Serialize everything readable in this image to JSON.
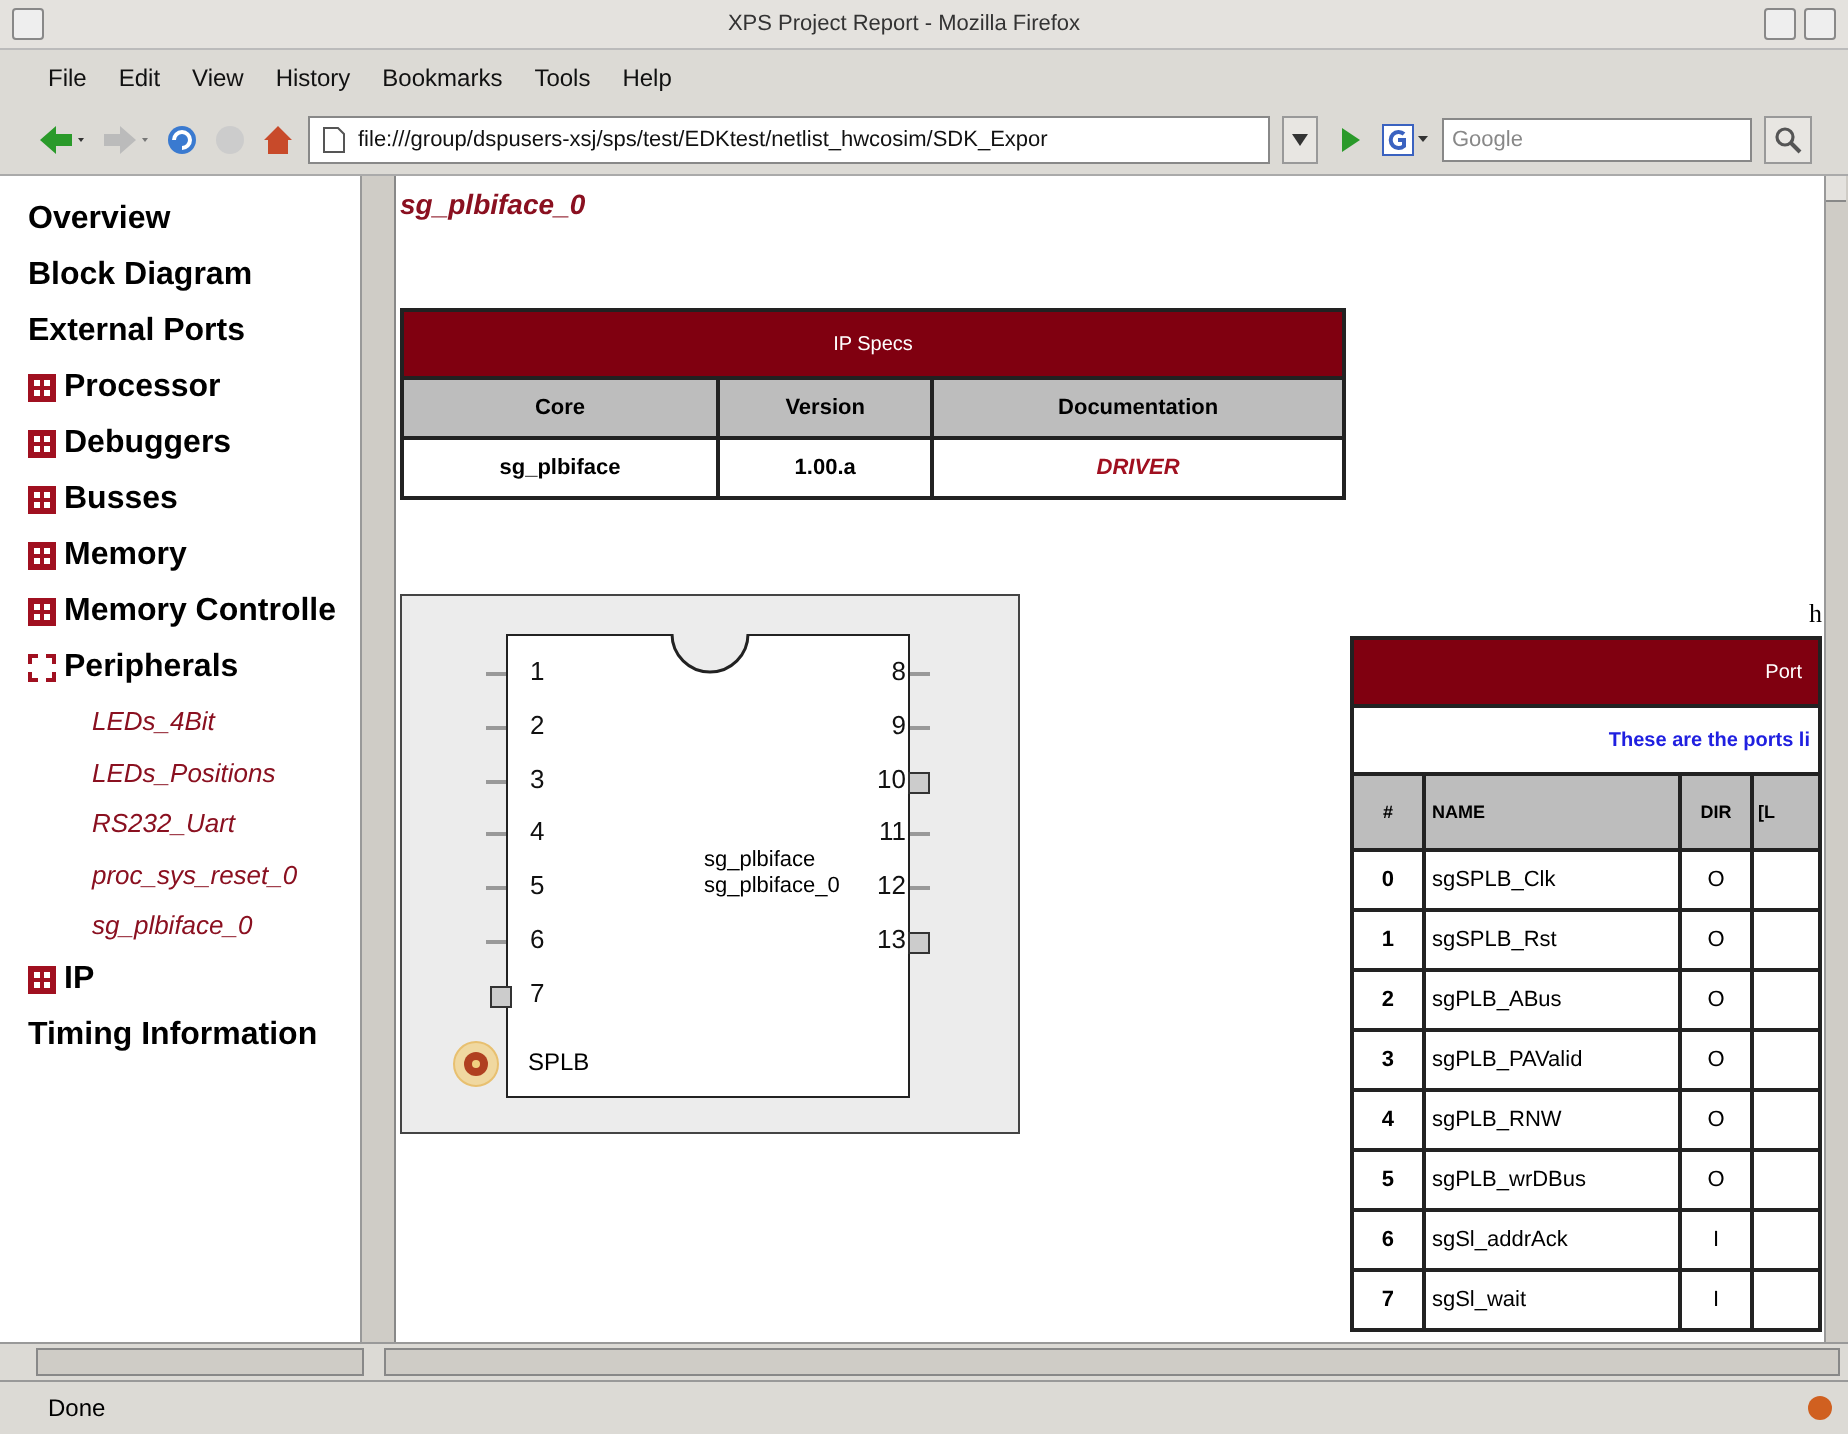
{
  "window": {
    "title": "XPS Project Report - Mozilla Firefox"
  },
  "menu": [
    "File",
    "Edit",
    "View",
    "History",
    "Bookmarks",
    "Tools",
    "Help"
  ],
  "address": {
    "value": "file:///group/dspusers-xsj/sps/test/EDKtest/netlist_hwcosim/SDK_Expor"
  },
  "search": {
    "placeholder": "Google"
  },
  "sidebar": {
    "items": [
      {
        "label": "Overview",
        "kind": "link"
      },
      {
        "label": "Block Diagram",
        "kind": "link"
      },
      {
        "label": "External Ports",
        "kind": "link"
      },
      {
        "label": "Processor",
        "kind": "group",
        "expanded": false
      },
      {
        "label": "Debuggers",
        "kind": "group",
        "expanded": false
      },
      {
        "label": "Busses",
        "kind": "group",
        "expanded": false
      },
      {
        "label": "Memory",
        "kind": "group",
        "expanded": false
      },
      {
        "label": "Memory Controlle",
        "kind": "group",
        "expanded": false
      },
      {
        "label": "Peripherals",
        "kind": "group",
        "expanded": true,
        "children": [
          "LEDs_4Bit",
          "LEDs_Positions",
          "RS232_Uart",
          "proc_sys_reset_0",
          "sg_plbiface_0"
        ]
      },
      {
        "label": "IP",
        "kind": "group",
        "expanded": false
      },
      {
        "label": "Timing Information",
        "kind": "link"
      }
    ]
  },
  "page_title": "sg_plbiface_0",
  "ip_specs": {
    "title": "IP Specs",
    "columns": [
      "Core",
      "Version",
      "Documentation"
    ],
    "row": [
      "sg_plbiface",
      "1.00.a",
      "DRIVER"
    ]
  },
  "diagram": {
    "left_pins": [
      {
        "label": "1",
        "kind": "line"
      },
      {
        "label": "2",
        "kind": "line"
      },
      {
        "label": "3",
        "kind": "line"
      },
      {
        "label": "4",
        "kind": "line"
      },
      {
        "label": "5",
        "kind": "line"
      },
      {
        "label": "6",
        "kind": "line"
      },
      {
        "label": "7",
        "kind": "square"
      }
    ],
    "right_pins": [
      {
        "label": "8",
        "kind": "line"
      },
      {
        "label": "9",
        "kind": "line"
      },
      {
        "label": "10",
        "kind": "square"
      },
      {
        "label": "11",
        "kind": "line"
      },
      {
        "label": "12",
        "kind": "line"
      },
      {
        "label": "13",
        "kind": "square"
      }
    ],
    "bus": "SPLB",
    "type_label": "sg_plbiface",
    "instance_label": "sg_plbiface_0"
  },
  "stray_text": "h",
  "ports": {
    "title": "Port",
    "note": "These are the ports li",
    "columns": [
      "#",
      "NAME",
      "DIR",
      "[L"
    ],
    "rows": [
      [
        "0",
        "sgSPLB_Clk",
        "O"
      ],
      [
        "1",
        "sgSPLB_Rst",
        "O"
      ],
      [
        "2",
        "sgPLB_ABus",
        "O"
      ],
      [
        "3",
        "sgPLB_PAValid",
        "O"
      ],
      [
        "4",
        "sgPLB_RNW",
        "O"
      ],
      [
        "5",
        "sgPLB_wrDBus",
        "O"
      ],
      [
        "6",
        "sgSl_addrAck",
        "I"
      ],
      [
        "7",
        "sgSl_wait",
        "I"
      ]
    ]
  },
  "status_bar": {
    "text": "Done"
  }
}
